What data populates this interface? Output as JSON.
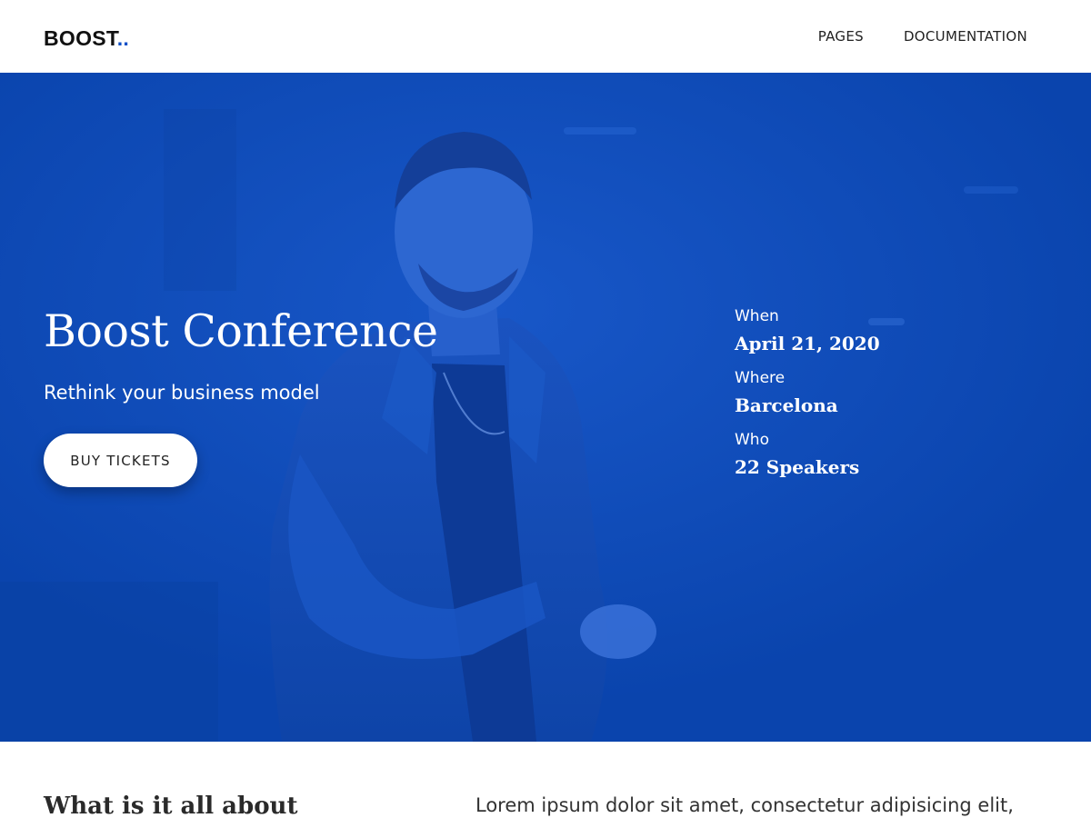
{
  "header": {
    "logo_text": "BOOST",
    "logo_dots": "..",
    "nav": [
      {
        "label": "PAGES"
      },
      {
        "label": "DOCUMENTATION"
      }
    ]
  },
  "hero": {
    "title": "Boost Conference",
    "subtitle": "Rethink your business model",
    "cta_label": "BUY TICKETS",
    "bg_color": "#0c4ab6",
    "details": [
      {
        "label": "When",
        "value": "April 21, 2020"
      },
      {
        "label": "Where",
        "value": "Barcelona"
      },
      {
        "label": "Who",
        "value": "22 Speakers"
      }
    ]
  },
  "about": {
    "title": "What is it all about",
    "text": "Lorem ipsum dolor sit amet, consectetur adipisicing elit,"
  },
  "colors": {
    "accent": "#0d4fc7",
    "hero_overlay": "#0c4ab6"
  }
}
